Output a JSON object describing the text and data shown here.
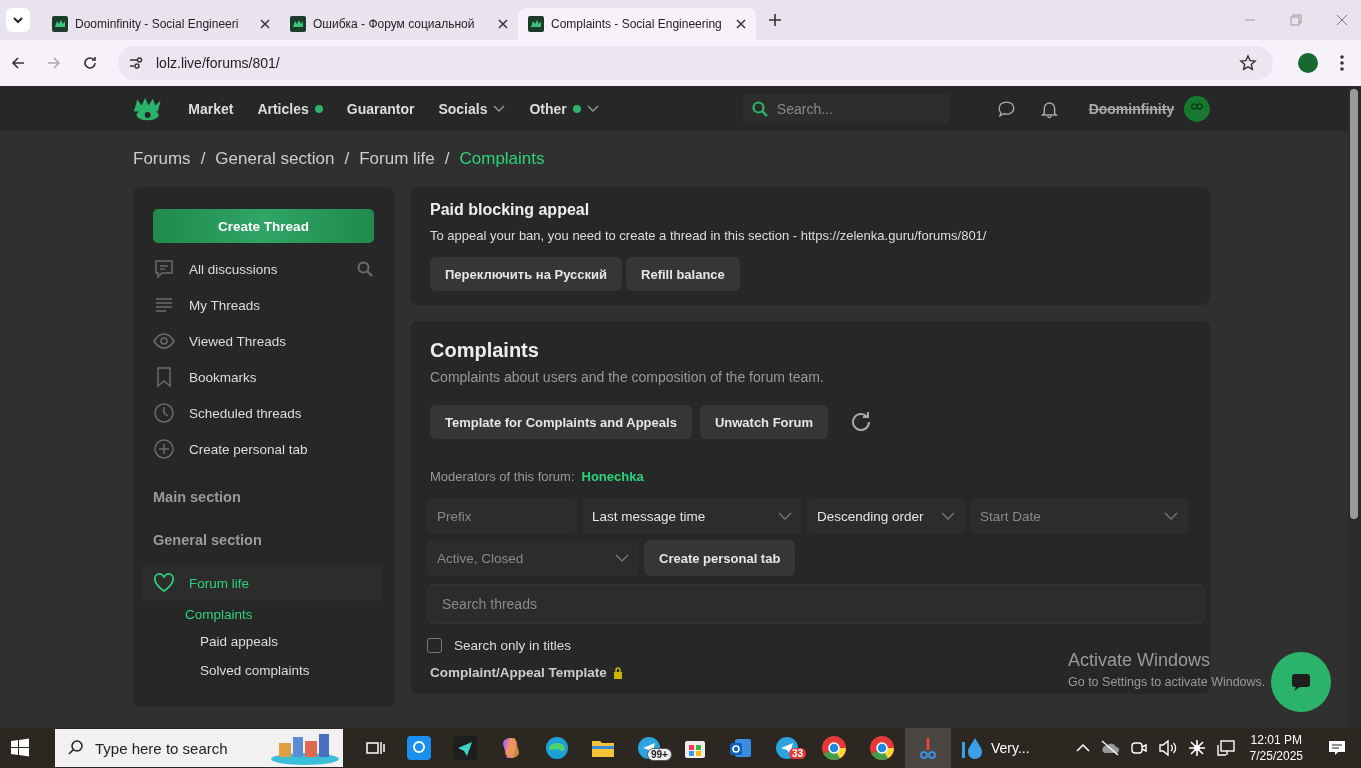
{
  "browser": {
    "tabs": [
      {
        "title": "Doominfinity - Social Engineeri",
        "selected": false
      },
      {
        "title": "Ошибка - Форум социальной",
        "selected": false
      },
      {
        "title": "Complaints - Social Engineering",
        "selected": true
      }
    ],
    "url": "lolz.live/forums/801/"
  },
  "site": {
    "nav": [
      {
        "label": "Market",
        "dot": false,
        "dropdown": false
      },
      {
        "label": "Articles",
        "dot": true,
        "dropdown": false
      },
      {
        "label": "Guarantor",
        "dot": false,
        "dropdown": false
      },
      {
        "label": "Socials",
        "dot": false,
        "dropdown": true
      },
      {
        "label": "Other",
        "dot": true,
        "dropdown": true
      }
    ],
    "search": {
      "placeholder": "Search..."
    },
    "username": "Doominfinity"
  },
  "breadcrumbs": [
    {
      "label": "Forums",
      "selected": false
    },
    {
      "separator": "/",
      "label": "General section",
      "selected": false
    },
    {
      "separator": "/",
      "label": "Forum life",
      "selected": false
    },
    {
      "separator": "/",
      "label": "Complaints",
      "selected": true
    }
  ],
  "sidebar": {
    "create_button": "Create Thread",
    "items": [
      {
        "label": "All discussions",
        "kind": "chat"
      },
      {
        "label": "My Threads",
        "kind": "lines"
      },
      {
        "label": "Viewed Threads",
        "kind": "eye"
      },
      {
        "label": "Bookmarks",
        "kind": "bookmark"
      },
      {
        "label": "Scheduled threads",
        "kind": "clock"
      },
      {
        "label": "Create personal tab",
        "kind": "plus"
      }
    ],
    "sections": [
      "Main section",
      "General section"
    ],
    "tree": [
      {
        "label": "Forum life",
        "selected": false,
        "children": [
          {
            "label": "Complaints",
            "selected": true,
            "children": [
              {
                "label": "Paid appeals",
                "selected": false
              },
              {
                "label": "Solved complaints",
                "selected": false
              }
            ]
          }
        ]
      }
    ]
  },
  "notice": {
    "title": "Paid blocking appeal",
    "text": "To appeal your ban, you need to create a thread in this section - https://zelenka.guru/forums/801/",
    "buttons": [
      "Переключить на Русский",
      "Refill balance"
    ]
  },
  "forum": {
    "title": "Complaints",
    "description": "Complaints about users and the composition of the forum team.",
    "buttons": [
      "Template for Complaints and Appeals",
      "Unwatch Forum"
    ],
    "moderators_label": "Moderators of this forum:",
    "moderator": "Honechka",
    "filters": [
      {
        "kind": "text",
        "placeholder": "Prefix"
      },
      {
        "kind": "select",
        "value": "Last message time"
      },
      {
        "kind": "select",
        "value": "Descending order"
      },
      {
        "kind": "select",
        "placeholder": "Start Date"
      },
      {
        "kind": "select",
        "placeholder": "Active, Closed"
      }
    ],
    "create_tab": "Create personal tab",
    "search": {
      "placeholder": "Search threads"
    },
    "titles_only": {
      "label": "Search only in titles",
      "checked": false
    },
    "thread_title": "Complaint/Appeal Template"
  },
  "activation": {
    "title": "Activate Windows",
    "text": "Go to Settings to activate Windows."
  },
  "taskbar": {
    "search": {
      "placeholder": "Type here to search"
    },
    "badges": [
      "99+",
      "33"
    ],
    "weather": "Very...",
    "time": "12:01 PM",
    "date": "7/25/2025"
  }
}
